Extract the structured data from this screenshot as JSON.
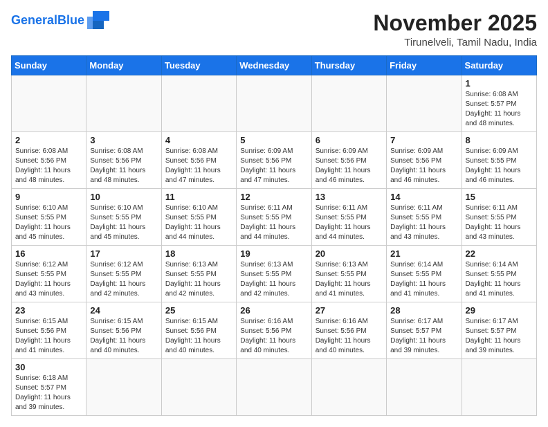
{
  "header": {
    "logo": {
      "line1": "General",
      "line2": "Blue"
    },
    "title": "November 2025",
    "location": "Tirunelveli, Tamil Nadu, India"
  },
  "weekdays": [
    "Sunday",
    "Monday",
    "Tuesday",
    "Wednesday",
    "Thursday",
    "Friday",
    "Saturday"
  ],
  "weeks": [
    [
      {
        "day": "",
        "info": ""
      },
      {
        "day": "",
        "info": ""
      },
      {
        "day": "",
        "info": ""
      },
      {
        "day": "",
        "info": ""
      },
      {
        "day": "",
        "info": ""
      },
      {
        "day": "",
        "info": ""
      },
      {
        "day": "1",
        "info": "Sunrise: 6:08 AM\nSunset: 5:57 PM\nDaylight: 11 hours and 48 minutes."
      }
    ],
    [
      {
        "day": "2",
        "info": "Sunrise: 6:08 AM\nSunset: 5:56 PM\nDaylight: 11 hours and 48 minutes."
      },
      {
        "day": "3",
        "info": "Sunrise: 6:08 AM\nSunset: 5:56 PM\nDaylight: 11 hours and 48 minutes."
      },
      {
        "day": "4",
        "info": "Sunrise: 6:08 AM\nSunset: 5:56 PM\nDaylight: 11 hours and 47 minutes."
      },
      {
        "day": "5",
        "info": "Sunrise: 6:09 AM\nSunset: 5:56 PM\nDaylight: 11 hours and 47 minutes."
      },
      {
        "day": "6",
        "info": "Sunrise: 6:09 AM\nSunset: 5:56 PM\nDaylight: 11 hours and 46 minutes."
      },
      {
        "day": "7",
        "info": "Sunrise: 6:09 AM\nSunset: 5:56 PM\nDaylight: 11 hours and 46 minutes."
      },
      {
        "day": "8",
        "info": "Sunrise: 6:09 AM\nSunset: 5:55 PM\nDaylight: 11 hours and 46 minutes."
      }
    ],
    [
      {
        "day": "9",
        "info": "Sunrise: 6:10 AM\nSunset: 5:55 PM\nDaylight: 11 hours and 45 minutes."
      },
      {
        "day": "10",
        "info": "Sunrise: 6:10 AM\nSunset: 5:55 PM\nDaylight: 11 hours and 45 minutes."
      },
      {
        "day": "11",
        "info": "Sunrise: 6:10 AM\nSunset: 5:55 PM\nDaylight: 11 hours and 44 minutes."
      },
      {
        "day": "12",
        "info": "Sunrise: 6:11 AM\nSunset: 5:55 PM\nDaylight: 11 hours and 44 minutes."
      },
      {
        "day": "13",
        "info": "Sunrise: 6:11 AM\nSunset: 5:55 PM\nDaylight: 11 hours and 44 minutes."
      },
      {
        "day": "14",
        "info": "Sunrise: 6:11 AM\nSunset: 5:55 PM\nDaylight: 11 hours and 43 minutes."
      },
      {
        "day": "15",
        "info": "Sunrise: 6:11 AM\nSunset: 5:55 PM\nDaylight: 11 hours and 43 minutes."
      }
    ],
    [
      {
        "day": "16",
        "info": "Sunrise: 6:12 AM\nSunset: 5:55 PM\nDaylight: 11 hours and 43 minutes."
      },
      {
        "day": "17",
        "info": "Sunrise: 6:12 AM\nSunset: 5:55 PM\nDaylight: 11 hours and 42 minutes."
      },
      {
        "day": "18",
        "info": "Sunrise: 6:13 AM\nSunset: 5:55 PM\nDaylight: 11 hours and 42 minutes."
      },
      {
        "day": "19",
        "info": "Sunrise: 6:13 AM\nSunset: 5:55 PM\nDaylight: 11 hours and 42 minutes."
      },
      {
        "day": "20",
        "info": "Sunrise: 6:13 AM\nSunset: 5:55 PM\nDaylight: 11 hours and 41 minutes."
      },
      {
        "day": "21",
        "info": "Sunrise: 6:14 AM\nSunset: 5:55 PM\nDaylight: 11 hours and 41 minutes."
      },
      {
        "day": "22",
        "info": "Sunrise: 6:14 AM\nSunset: 5:55 PM\nDaylight: 11 hours and 41 minutes."
      }
    ],
    [
      {
        "day": "23",
        "info": "Sunrise: 6:15 AM\nSunset: 5:56 PM\nDaylight: 11 hours and 41 minutes."
      },
      {
        "day": "24",
        "info": "Sunrise: 6:15 AM\nSunset: 5:56 PM\nDaylight: 11 hours and 40 minutes."
      },
      {
        "day": "25",
        "info": "Sunrise: 6:15 AM\nSunset: 5:56 PM\nDaylight: 11 hours and 40 minutes."
      },
      {
        "day": "26",
        "info": "Sunrise: 6:16 AM\nSunset: 5:56 PM\nDaylight: 11 hours and 40 minutes."
      },
      {
        "day": "27",
        "info": "Sunrise: 6:16 AM\nSunset: 5:56 PM\nDaylight: 11 hours and 40 minutes."
      },
      {
        "day": "28",
        "info": "Sunrise: 6:17 AM\nSunset: 5:57 PM\nDaylight: 11 hours and 39 minutes."
      },
      {
        "day": "29",
        "info": "Sunrise: 6:17 AM\nSunset: 5:57 PM\nDaylight: 11 hours and 39 minutes."
      }
    ],
    [
      {
        "day": "30",
        "info": "Sunrise: 6:18 AM\nSunset: 5:57 PM\nDaylight: 11 hours and 39 minutes."
      },
      {
        "day": "",
        "info": ""
      },
      {
        "day": "",
        "info": ""
      },
      {
        "day": "",
        "info": ""
      },
      {
        "day": "",
        "info": ""
      },
      {
        "day": "",
        "info": ""
      },
      {
        "day": "",
        "info": ""
      }
    ]
  ]
}
